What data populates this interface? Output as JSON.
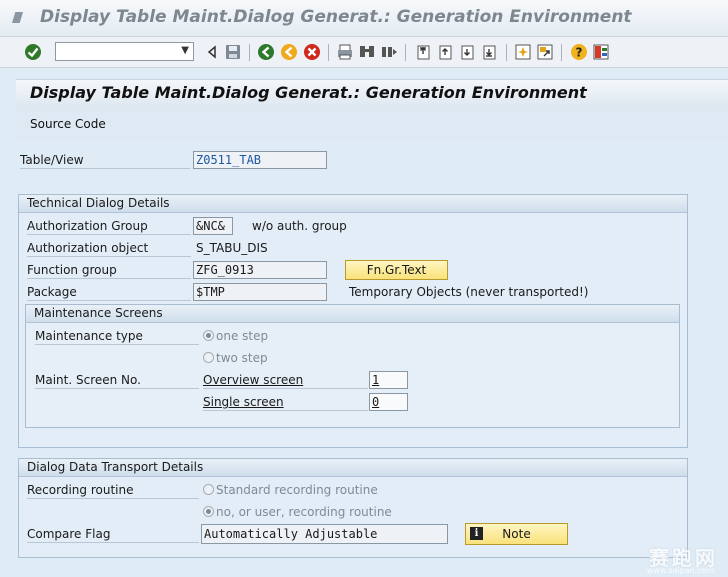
{
  "window": {
    "title": "Display Table Maint.Dialog Generat.: Generation Environment"
  },
  "toolbar": {
    "command_field_value": "",
    "icons": [
      "enter-check-icon",
      "dropdown-icon",
      "collapse-icon",
      "save-icon",
      "back-icon",
      "exit-icon",
      "cancel-icon",
      "print-icon",
      "find-icon",
      "find-next-icon",
      "first-page-icon",
      "previous-page-icon",
      "next-page-icon",
      "last-page-icon",
      "new-session-icon",
      "shortcut-icon",
      "help-icon",
      "layout-icon"
    ]
  },
  "header": {
    "title": "Display Table Maint.Dialog Generat.: Generation Environment"
  },
  "app_toolbar": {
    "source_code_label": "Source Code"
  },
  "table_view": {
    "label": "Table/View",
    "value": "Z0511_TAB"
  },
  "technical": {
    "title": "Technical Dialog Details",
    "auth_group_label": "Authorization Group",
    "auth_group_value": "&NC&",
    "auth_group_text": "w/o auth. group",
    "auth_object_label": "Authorization object",
    "auth_object_value": "S_TABU_DIS",
    "function_group_label": "Function group",
    "function_group_value": "ZFG_0913",
    "fngr_button": "Fn.Gr.Text",
    "package_label": "Package",
    "package_value": "$TMP",
    "package_text": "Temporary Objects (never transported!)"
  },
  "maintenance": {
    "title": "Maintenance Screens",
    "type_label": "Maintenance type",
    "one_step": "one step",
    "two_step": "two step",
    "screen_no_label": "Maint. Screen No.",
    "overview_label": "Overview screen",
    "overview_value": "1",
    "single_label": "Single screen",
    "single_value": "0"
  },
  "transport": {
    "title": "Dialog Data Transport Details",
    "recording_label": "Recording routine",
    "standard_option": "Standard recording routine",
    "user_option": "no, or user, recording routine",
    "compare_label": "Compare Flag",
    "compare_value": "Automatically Adjustable",
    "note_button": "Note"
  },
  "watermark": {
    "text": "赛跑网",
    "url": "www.saipao.com"
  },
  "colors": {
    "accent_yellow": "#f9e27a",
    "group_border": "#a8bdd1",
    "background": "#dfebf5"
  }
}
